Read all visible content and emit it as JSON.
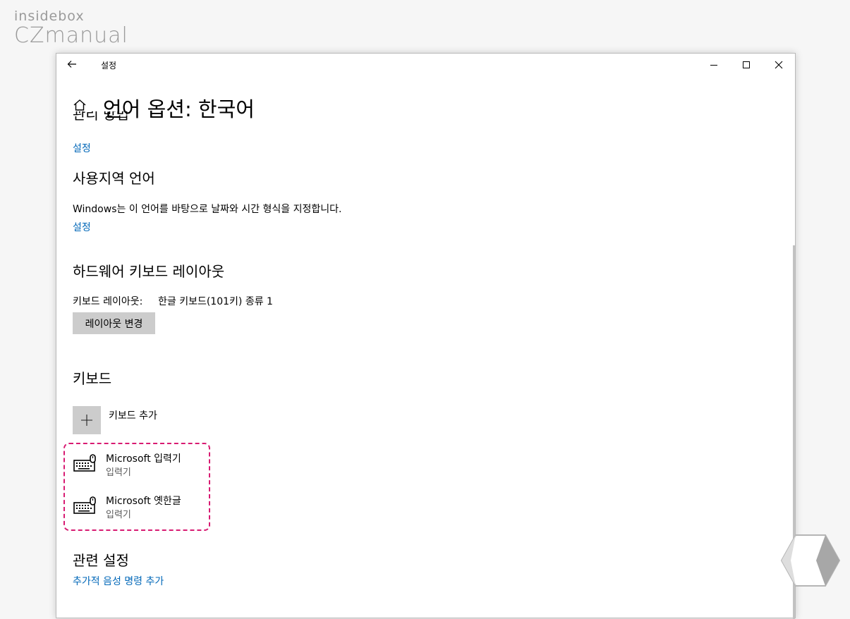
{
  "watermark": {
    "line1": "insidebox",
    "line2": "CZmanual"
  },
  "window": {
    "title": "설정"
  },
  "page": {
    "title": "언어 옵션: 한국어",
    "clipped_heading": "관리 방법"
  },
  "sections": {
    "top_link": "설정",
    "region_language": {
      "heading": "사용지역 언어",
      "description": "Windows는 이 언어를 바탕으로 날짜와 시간 형식을 지정합니다.",
      "link": "설정"
    },
    "hardware_keyboard": {
      "heading": "하드웨어 키보드 레이아웃",
      "layout_label": "키보드 레이아웃:",
      "layout_value": "한글 키보드(101키) 종류 1",
      "change_button": "레이아웃 변경"
    },
    "keyboards": {
      "heading": "키보드",
      "add_label": "키보드 추가",
      "items": [
        {
          "name": "Microsoft 입력기",
          "type": "입력기",
          "icon": "keyboard-icon"
        },
        {
          "name": "Microsoft 옛한글",
          "type": "입력기",
          "icon": "keyboard-icon"
        }
      ]
    },
    "related": {
      "heading": "관련 설정",
      "link": "추가적 음성 명령 추가"
    }
  },
  "colors": {
    "link": "#0067b8",
    "highlight": "#d81b72",
    "button": "#cccccc"
  }
}
